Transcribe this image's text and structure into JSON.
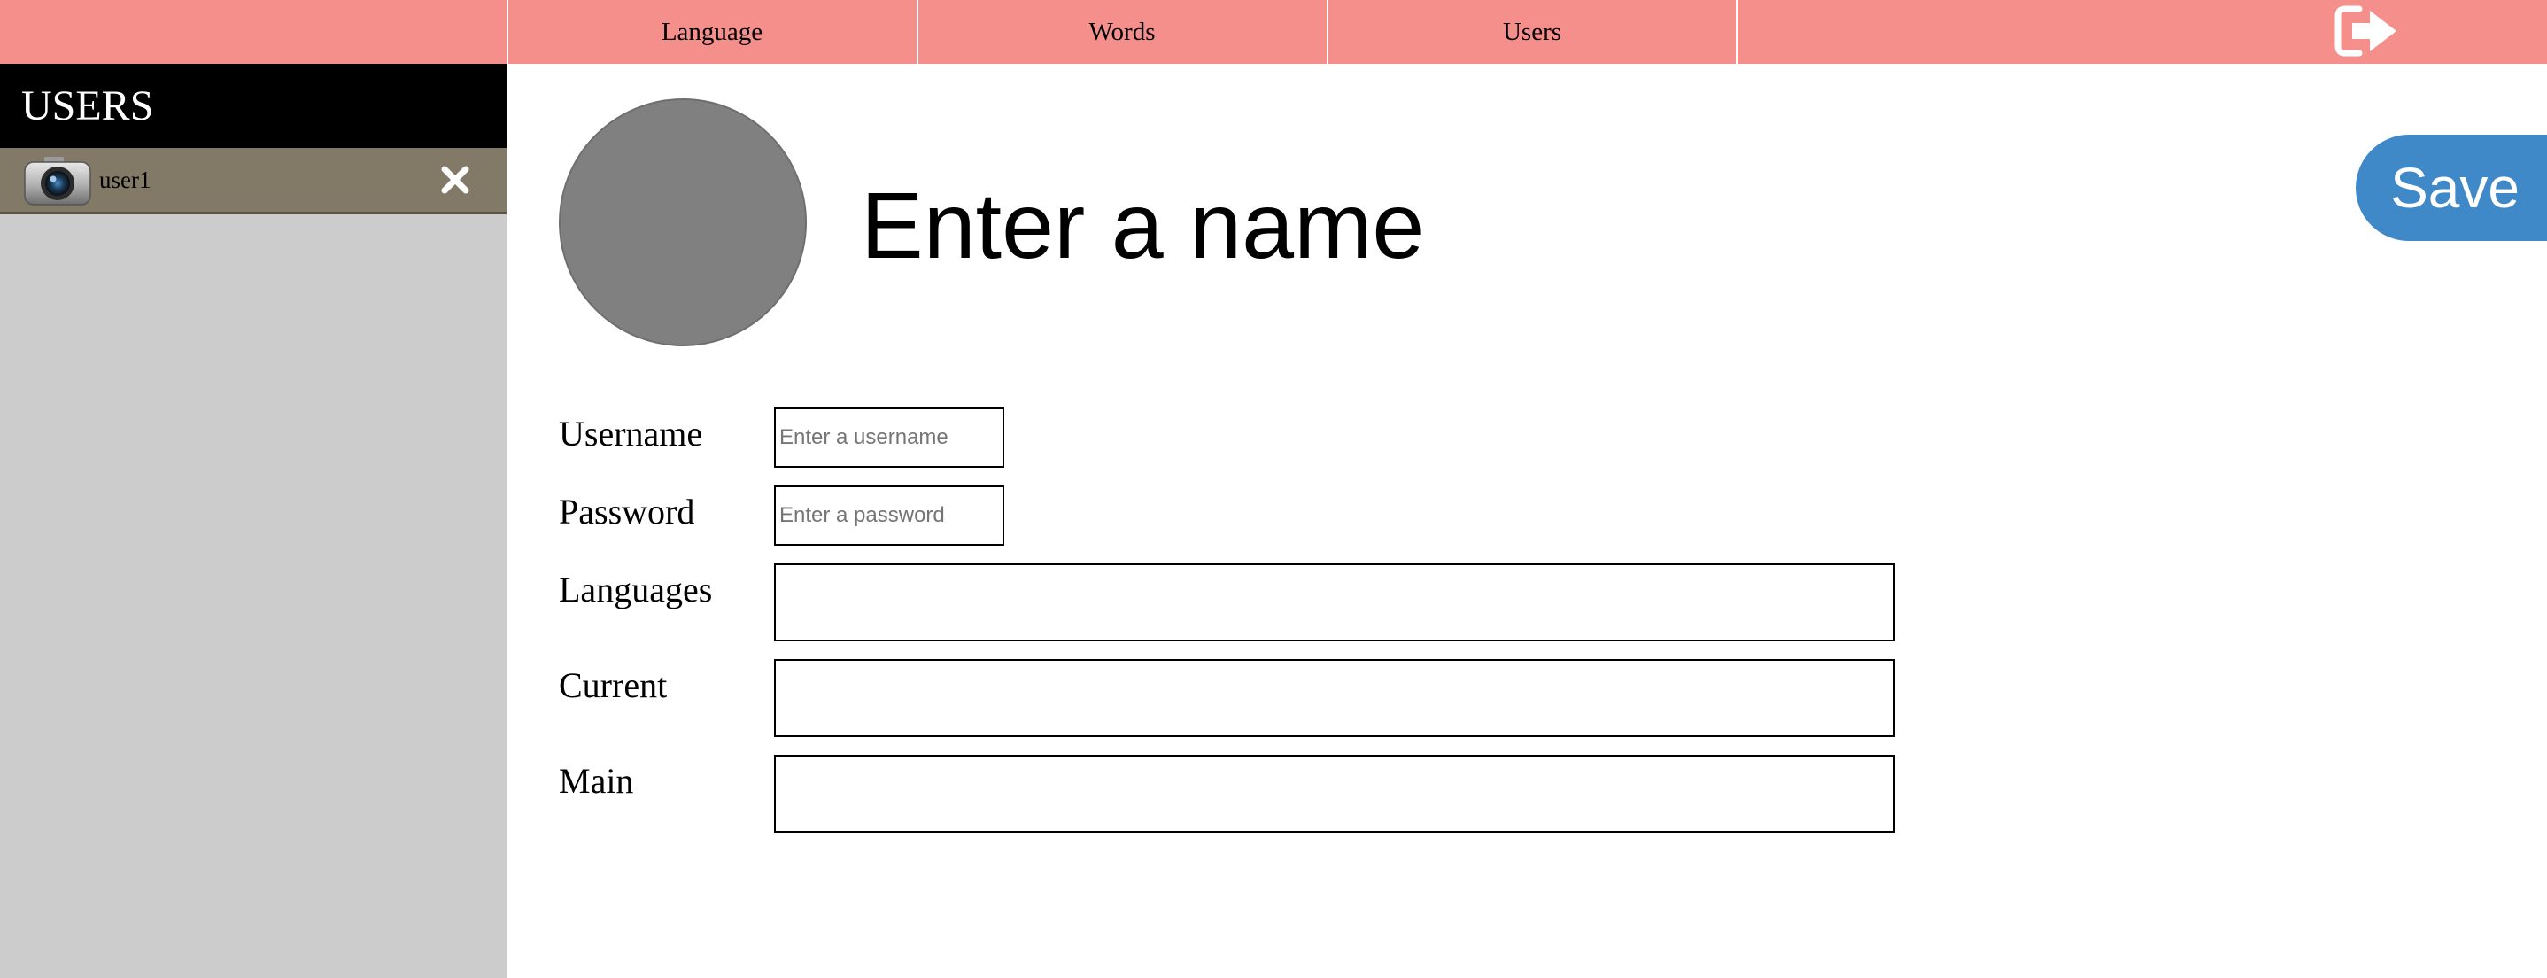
{
  "nav": {
    "tabs": [
      {
        "label": "Language"
      },
      {
        "label": "Words"
      },
      {
        "label": "Users"
      }
    ],
    "logout_icon": "logout-icon",
    "bar_color": "#f48f8c"
  },
  "sidebar": {
    "title": "USERS",
    "users": [
      {
        "name": "user1",
        "avatar_icon": "camera-icon"
      }
    ],
    "delete_icon": "close-icon"
  },
  "profile": {
    "name_placeholder": "Enter a name",
    "save_label": "Save",
    "save_color": "#3f89c8"
  },
  "form": {
    "username_label": "Username",
    "username_placeholder": "Enter a username",
    "username_value": "",
    "password_label": "Password",
    "password_placeholder": "Enter a password",
    "password_value": "",
    "languages_label": "Languages",
    "current_label": "Current",
    "main_label": "Main"
  }
}
